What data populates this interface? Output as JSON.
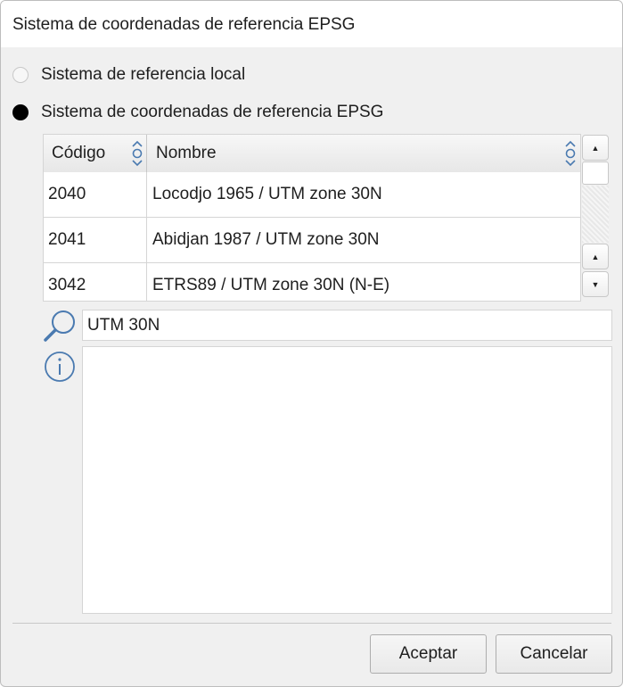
{
  "window": {
    "title": "Sistema de coordenadas de referencia EPSG"
  },
  "options": [
    {
      "label": "Sistema de referencia local",
      "checked": false
    },
    {
      "label": "Sistema de coordenadas de referencia EPSG",
      "checked": true
    }
  ],
  "table": {
    "columns": [
      "Código",
      "Nombre"
    ],
    "rows": [
      {
        "code": "2040",
        "name": "Locodjo 1965 / UTM zone 30N"
      },
      {
        "code": "2041",
        "name": "Abidjan 1987 / UTM zone 30N"
      },
      {
        "code": "3042",
        "name": "ETRS89 / UTM zone 30N (N-E)"
      }
    ]
  },
  "search": {
    "value": "UTM 30N"
  },
  "info": {
    "text": ""
  },
  "buttons": {
    "accept": "Aceptar",
    "cancel": "Cancelar"
  },
  "colors": {
    "accent_icon": "#4a7ab0"
  }
}
